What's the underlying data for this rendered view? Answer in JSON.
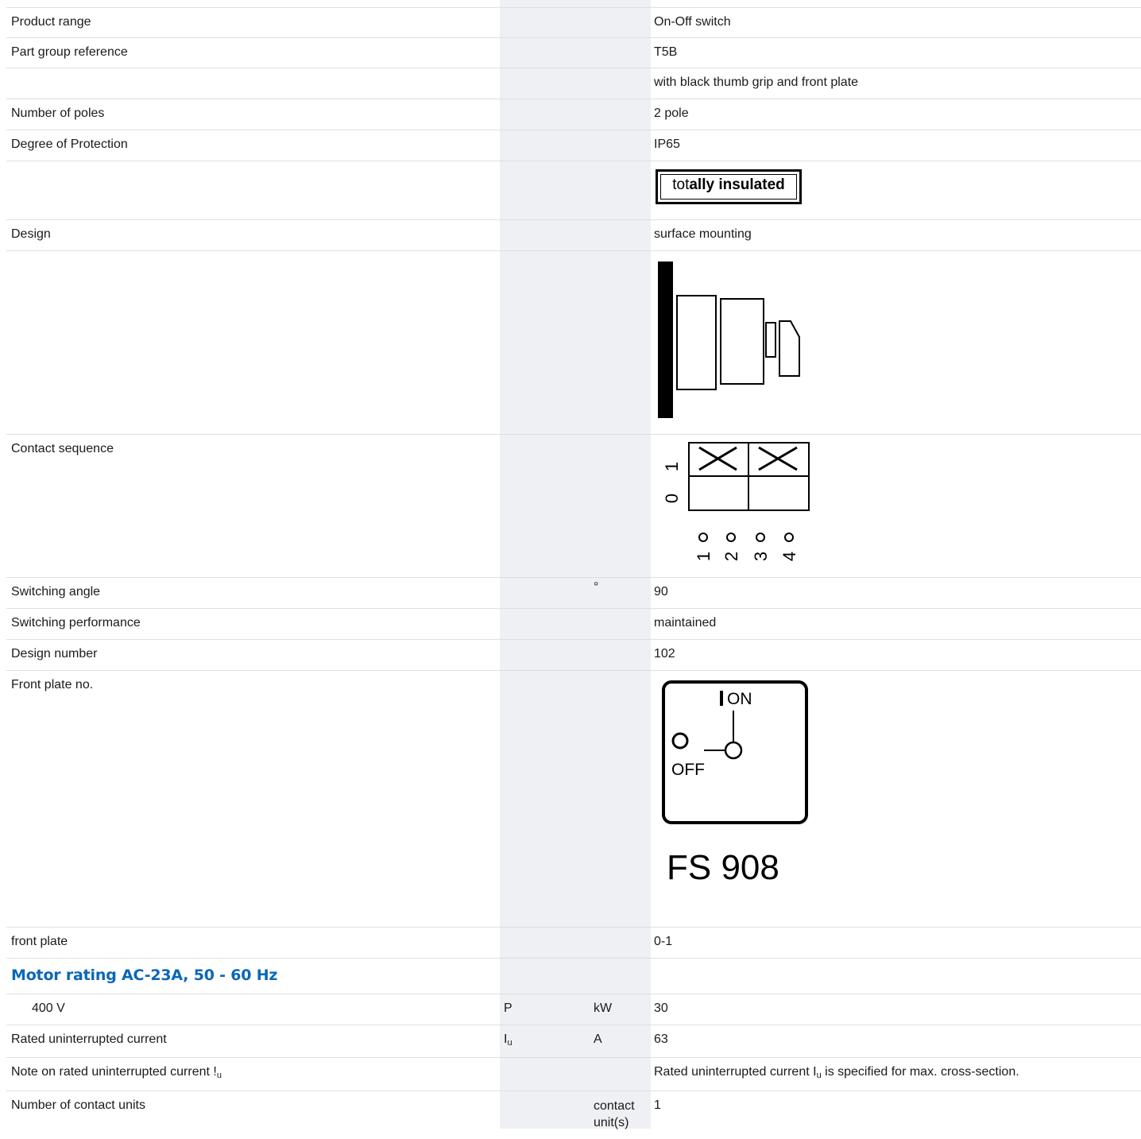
{
  "rows": {
    "product_range": {
      "label": "Product range",
      "value": "On-Off switch"
    },
    "part_group": {
      "label": "Part group reference",
      "value": "T5B"
    },
    "grip": {
      "value": "with black thumb grip and front plate"
    },
    "poles": {
      "label": "Number of poles",
      "value": "2 pole"
    },
    "protection": {
      "label": "Degree of Protection",
      "value": "IP65"
    },
    "insulated_badge": {
      "text_a": "tot",
      "text_b": "ally ",
      "text_c": "insulated"
    },
    "design": {
      "label": "Design",
      "value": "surface mounting"
    },
    "contact_sequence": {
      "label": "Contact sequence",
      "pos1": "1",
      "pos0": "0",
      "terminals": [
        "1",
        "2",
        "3",
        "4"
      ]
    },
    "switching_angle": {
      "label": "Switching angle",
      "unit": "°",
      "value": "90"
    },
    "switching_perf": {
      "label": "Switching performance",
      "value": "maintained"
    },
    "design_number": {
      "label": "Design number",
      "value": "102"
    },
    "front_plate_no": {
      "label": "Front plate no.",
      "on_label": "ON",
      "off_label": "OFF",
      "code": "FS 908"
    },
    "front_plate": {
      "label": "front plate",
      "value": "0-1"
    },
    "motor_section": {
      "title": "Motor rating AC-23A, 50 - 60 Hz"
    },
    "motor_400v": {
      "label": "400 V",
      "symbol": "P",
      "unit": "kW",
      "value": "30"
    },
    "rated_current": {
      "label": "Rated uninterrupted current",
      "symbol": "I",
      "symbol_sub": "u",
      "unit": "A",
      "value": "63"
    },
    "note_current": {
      "label": "Note on rated uninterrupted current !",
      "label_sub": "u",
      "value_pre": "Rated uninterrupted current I",
      "value_sub": "u",
      "value_post": " is specified for max. cross-section."
    },
    "contact_units": {
      "label": "Number of contact units",
      "unit": "contact unit(s)",
      "value": "1"
    }
  }
}
